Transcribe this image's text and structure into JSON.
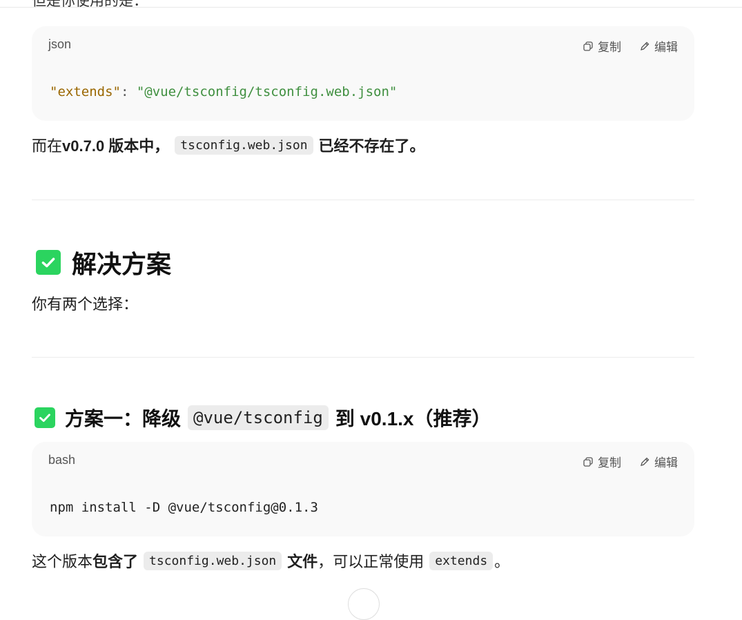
{
  "top": {
    "partial_text": "但是你使用的是："
  },
  "code1": {
    "lang": "json",
    "copy_label": "复制",
    "edit_label": "编辑",
    "key": "\"extends\"",
    "colon": ": ",
    "value": "\"@vue/tsconfig/tsconfig.web.json\""
  },
  "para1": {
    "prefix": "而在 ",
    "bold1": "v0.7.0 版本中，",
    "code": "tsconfig.web.json",
    "bold2": "已经不存在了。"
  },
  "section": {
    "title": "解决方案",
    "intro": "你有两个选择："
  },
  "option1": {
    "prefix": "方案一：降级",
    "code": "@vue/tsconfig",
    "suffix": "到 v0.1.x（推荐）"
  },
  "code2": {
    "lang": "bash",
    "copy_label": "复制",
    "edit_label": "编辑",
    "command": "npm install -D @vue/tsconfig@0.1.3"
  },
  "para2": {
    "prefix": "这个版本 ",
    "bold1": "包含了",
    "code": "tsconfig.web.json",
    "bold2": "文件",
    "mid": "，可以正常使用",
    "code2": "extends",
    "end": "。"
  },
  "colors": {
    "check_green": "#2bd45f",
    "json_key": "#9a6700",
    "json_string": "#3f8f3f"
  }
}
